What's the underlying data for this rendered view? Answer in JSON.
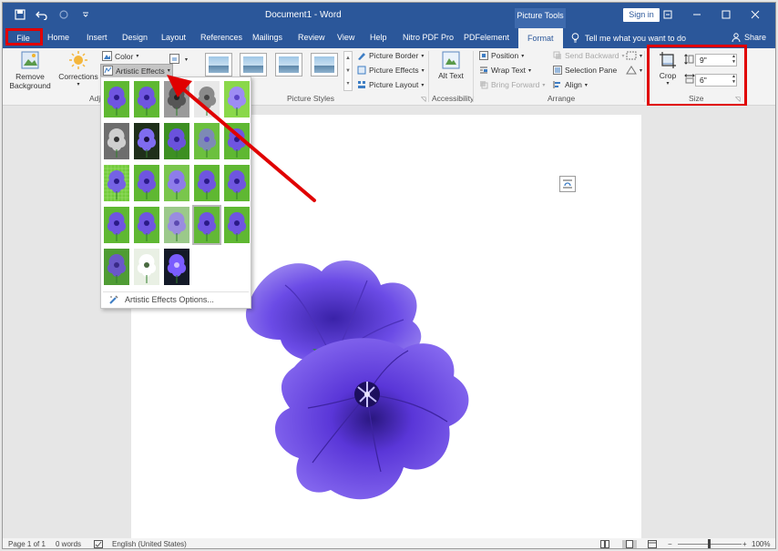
{
  "window": {
    "doc_title": "Document1  -  Word",
    "context_tab_group": "Picture Tools",
    "sign_in": "Sign in"
  },
  "tabs": [
    {
      "label": "File"
    },
    {
      "label": "Home"
    },
    {
      "label": "Insert"
    },
    {
      "label": "Design"
    },
    {
      "label": "Layout"
    },
    {
      "label": "References"
    },
    {
      "label": "Mailings"
    },
    {
      "label": "Review"
    },
    {
      "label": "View"
    },
    {
      "label": "Help"
    },
    {
      "label": "Nitro PDF Pro"
    },
    {
      "label": "PDFelement"
    },
    {
      "label": "Format"
    }
  ],
  "tell_me": "Tell me what you want to do",
  "share": "Share",
  "ribbon": {
    "remove_background": "Remove Background",
    "corrections": "Corrections",
    "color": "Color",
    "artistic_effects": "Artistic Effects",
    "adjust_group": "Adj",
    "picture_border": "Picture Border",
    "picture_effects": "Picture Effects",
    "picture_layout": "Picture Layout",
    "picture_styles_group": "Picture Styles",
    "alt_text": "Alt Text",
    "accessibility_group": "Accessibility",
    "position": "Position",
    "wrap_text": "Wrap Text",
    "bring_forward": "Bring Forward",
    "send_backward": "Send Backward",
    "selection_pane": "Selection Pane",
    "align": "Align",
    "arrange_group": "Arrange",
    "crop": "Crop",
    "height_value": "9\"",
    "width_value": "6\"",
    "size_group": "Size"
  },
  "artistic_effects_menu": {
    "effects": [
      "plain",
      "plain",
      "mono",
      "sketch",
      "bright",
      "mono-dark",
      "dark",
      "green",
      "blur",
      "plain",
      "grid",
      "plain",
      "soft",
      "plain",
      "plain",
      "plain",
      "plain",
      "wash",
      "selected",
      "plain",
      "cutout",
      "glow",
      "neon"
    ],
    "options_label": "Artistic Effects Options..."
  },
  "status": {
    "page": "Page 1 of 1",
    "words": "0 words",
    "language": "English (United States)",
    "zoom": "100%"
  },
  "colors": {
    "accent": "#2b579a",
    "highlight": "#e00000",
    "flower": "#6a3de8"
  },
  "icons": [
    "save-icon",
    "undo-icon",
    "redo-icon",
    "customize-icon",
    "ribbon-display-icon",
    "minimize-icon",
    "maximize-icon",
    "close-icon",
    "lightbulb-icon",
    "share-person-icon",
    "remove-background-icon",
    "corrections-icon",
    "color-icon",
    "artistic-effects-icon",
    "picture-border-icon",
    "picture-effects-icon",
    "picture-layout-icon",
    "alt-text-icon",
    "position-icon",
    "wrap-text-icon",
    "crop-icon",
    "height-icon",
    "width-icon",
    "layout-options-icon",
    "proofing-icon",
    "print-layout-icon",
    "zoom-out-icon",
    "zoom-in-icon"
  ]
}
